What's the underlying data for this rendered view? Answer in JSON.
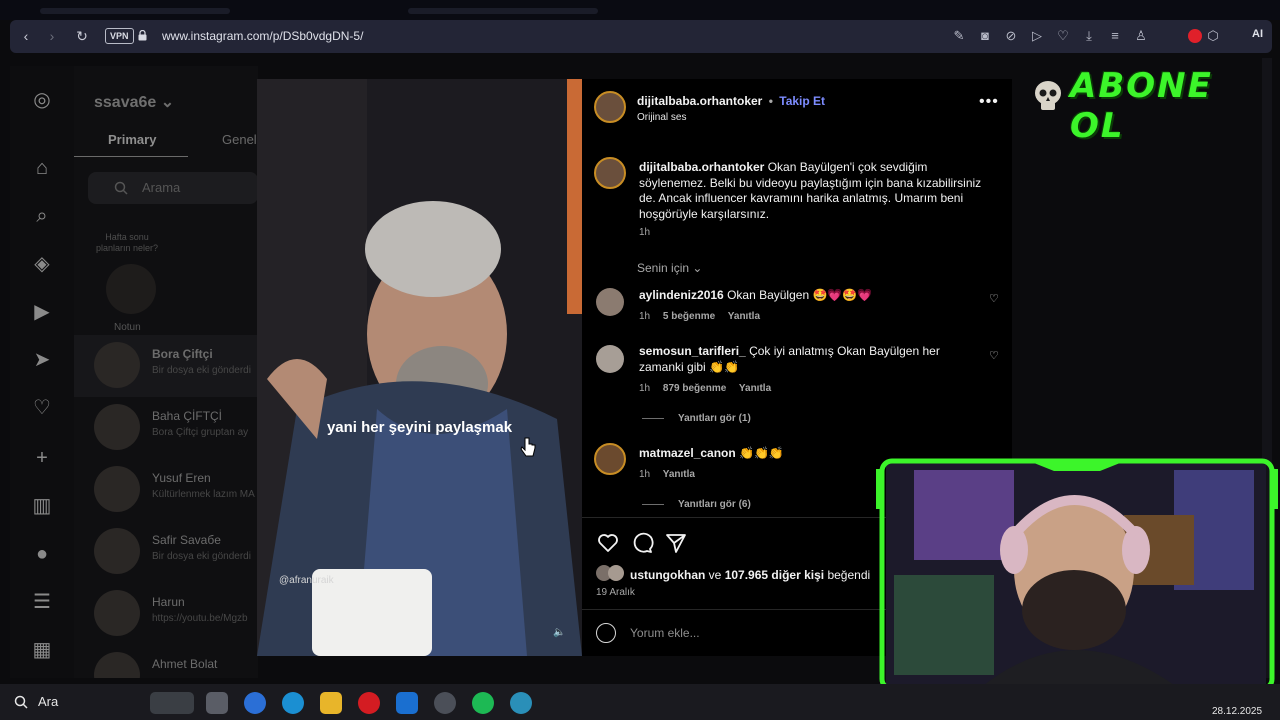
{
  "browser": {
    "vpn_label": "VPN",
    "url": "www.instagram.com/p/DSb0vdgDN-5/",
    "ai_label": "AI"
  },
  "dm": {
    "username": "ssava6e",
    "tab_primary": "Primary",
    "tab_general": "Genel",
    "search_placeholder": "Arama",
    "note_text": "Hafta sonu planların neler?",
    "notun_label": "Notun",
    "rows": [
      {
        "name": "Bora Çiftçi",
        "sub": "Bir dosya eki gönderdi"
      },
      {
        "name": "Baha ÇİFTÇİ",
        "sub": "Bora Çiftçi gruptan ay"
      },
      {
        "name": "Yusuf Eren",
        "sub": "Kültürlenmek lazım MA"
      },
      {
        "name": "Safir Savaбe",
        "sub": "Bir dosya eki gönderdi"
      },
      {
        "name": "Harun",
        "sub": "https://youtu.be/Mgzb"
      },
      {
        "name": "Ahmet Bolat",
        "sub": ""
      }
    ]
  },
  "video": {
    "subtitle": "yani her şeyini paylaşmak",
    "watermark": "@afranuraik"
  },
  "post": {
    "username": "dijitalbaba.orhantoker",
    "dot": "•",
    "follow_label": "Takip Et",
    "audio": "Orijinal ses",
    "caption_user": "dijitalbaba.orhantoker",
    "caption_text": "Okan Bayülgen'i çok sevdiğim söylenemez. Belki bu videoyu paylaştığım için bana kızabilirsiniz de. Ancak influencer kavramını harika anlatmış. Umarım beni hoşgörüyle karşılarsınız.",
    "caption_time": "1h",
    "sort_label": "Senin için",
    "comments": [
      {
        "user": "aylindeniz2016",
        "text": "Okan Bayülgen 🤩💗🤩💗",
        "time": "1h",
        "likes": "5 beğenme",
        "reply": "Yanıtla"
      },
      {
        "user": "semosun_tarifleri_",
        "text": "Çok iyi anlatmış Okan Bayülgen her zamanki gibi 👏👏",
        "time": "1h",
        "likes": "879 beğenme",
        "reply": "Yanıtla",
        "replies_label": "Yanıtları gör (1)"
      },
      {
        "user": "matmazel_canon",
        "text": "👏👏👏",
        "time": "1h",
        "reply": "Yanıtla",
        "replies_label": "Yanıtları gör (6)"
      }
    ],
    "liked_by_user": "ustungokhan",
    "liked_by_mid": "ve",
    "liked_by_count": "107.965 diğer kişi",
    "liked_by_suffix": "beğendi",
    "date": "19 Aralık",
    "comment_placeholder": "Yorum ekle..."
  },
  "overlay": {
    "abone_text": "ABONE OL"
  },
  "taskbar": {
    "search_label": "Ara",
    "clock": "28.12.2025"
  },
  "colors": {
    "follow": "#7d8cff",
    "abone_green": "#3cf52a",
    "cam_frame": "#3cf52a"
  }
}
